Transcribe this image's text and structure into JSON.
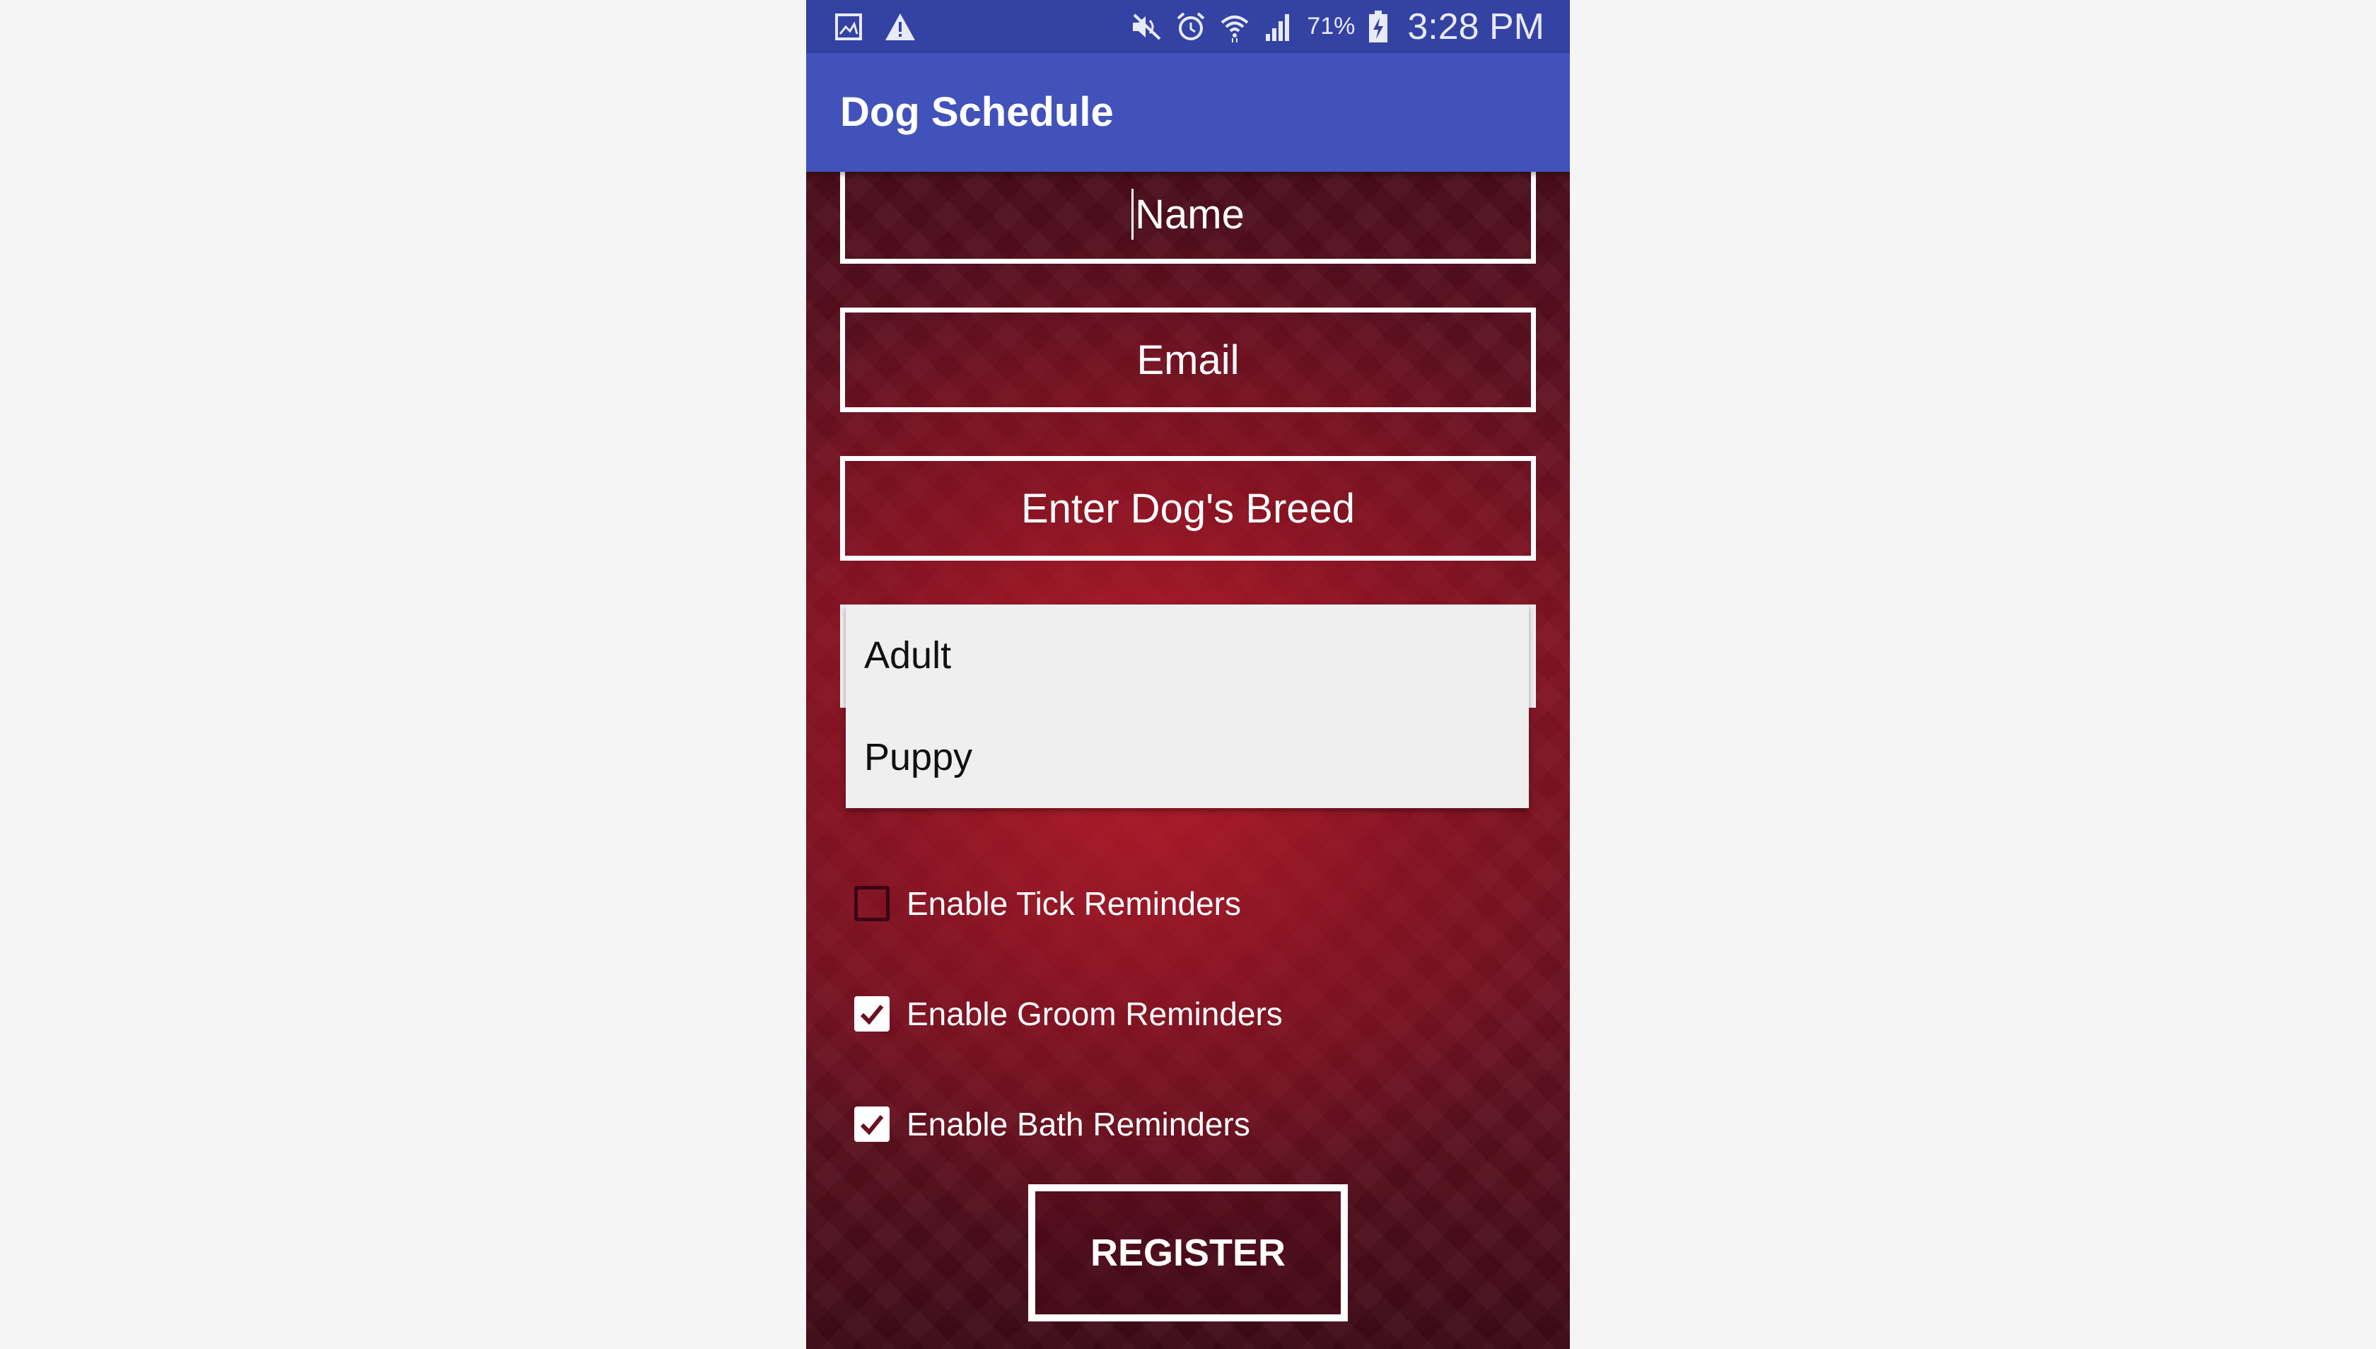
{
  "status_bar": {
    "left_icons": [
      "gallery-icon",
      "warning-icon"
    ],
    "right_icons": [
      "mute-icon",
      "alarm-icon",
      "wifi-icon",
      "signal-icon",
      "battery-charging-icon"
    ],
    "battery": "71%",
    "time": "3:28 PM"
  },
  "app_bar": {
    "title": "Dog Schedule"
  },
  "form": {
    "name_placeholder": "Name",
    "email_placeholder": "Email",
    "breed_placeholder": "Enter Dog's Breed",
    "age_options": [
      "Adult",
      "Puppy"
    ],
    "checkboxes": [
      {
        "label": "Enable Tick Reminders",
        "checked": false
      },
      {
        "label": "Enable Groom Reminders",
        "checked": true
      },
      {
        "label": "Enable Bath Reminders",
        "checked": true
      }
    ],
    "register_label": "REGISTER"
  },
  "colors": {
    "status_bar": "#3442a3",
    "app_bar": "#4152ba",
    "background_red": "#7a1424",
    "page_background": "#f5f5f5"
  }
}
